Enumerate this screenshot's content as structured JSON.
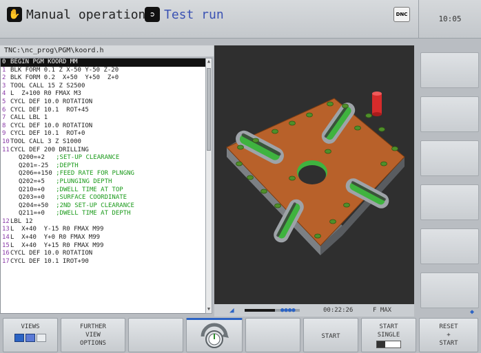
{
  "header": {
    "primary_mode": "Manual operation",
    "secondary_mode": "Test run",
    "dnc_badge": "DNC",
    "clock": "10:05"
  },
  "program": {
    "path": "TNC:\\nc_prog\\PGM\\koord.h",
    "lines": [
      {
        "n": "0",
        "code": "BEGIN PGM KOORD MM"
      },
      {
        "n": "1",
        "code": "BLK FORM 0.1 Z X-50 Y-50 Z-20"
      },
      {
        "n": "2",
        "code": "BLK FORM 0.2  X+50  Y+50  Z+0"
      },
      {
        "n": "3",
        "code": "TOOL CALL 15 Z S2500"
      },
      {
        "n": "4",
        "code": "L  Z+100 R0 FMAX M3"
      },
      {
        "n": "5",
        "code": "CYCL DEF 10.0 ROTATION"
      },
      {
        "n": "6",
        "code": "CYCL DEF 10.1  ROT+45"
      },
      {
        "n": "7",
        "code": "CALL LBL 1"
      },
      {
        "n": "8",
        "code": "CYCL DEF 10.0 ROTATION"
      },
      {
        "n": "9",
        "code": "CYCL DEF 10.1  ROT+0"
      },
      {
        "n": "10",
        "code": "TOOL CALL 3 Z S1000"
      },
      {
        "n": "11",
        "code": "CYCL DEF 200 DRILLING"
      },
      {
        "n": "",
        "code": "Q200=+2",
        "comment": ";SET-UP CLEARANCE"
      },
      {
        "n": "",
        "code": "Q201=-25",
        "comment": ";DEPTH"
      },
      {
        "n": "",
        "code": "Q206=+150",
        "comment": ";FEED RATE FOR PLNGNG"
      },
      {
        "n": "",
        "code": "Q202=+5",
        "comment": ";PLUNGING DEPTH"
      },
      {
        "n": "",
        "code": "Q210=+0",
        "comment": ";DWELL TIME AT TOP"
      },
      {
        "n": "",
        "code": "Q203=+0",
        "comment": ";SURFACE COORDINATE"
      },
      {
        "n": "",
        "code": "Q204=+50",
        "comment": ";2ND SET-UP CLEARANCE"
      },
      {
        "n": "",
        "code": "Q211=+0",
        "comment": ";DWELL TIME AT DEPTH"
      },
      {
        "n": "12",
        "code": "LBL 12"
      },
      {
        "n": "13",
        "code": "L  X+40  Y-15 R0 FMAX M99"
      },
      {
        "n": "14",
        "code": "L  X+40  Y+0 R0 FMAX M99"
      },
      {
        "n": "15",
        "code": "L  X+40  Y+15 R0 FMAX M99"
      },
      {
        "n": "16",
        "code": "CYCL DEF 10.0 ROTATION"
      },
      {
        "n": "17",
        "code": "CYCL DEF 10.1 IROT+90"
      }
    ]
  },
  "status": {
    "time": "00:22:26",
    "feed": "F MAX",
    "progress": 0.55
  },
  "softkeys": [
    {
      "label": "VIEWS",
      "name": "views-softkey"
    },
    {
      "label": "FURTHER\nVIEW\nOPTIONS",
      "name": "further-view-options-softkey"
    },
    {
      "label": "",
      "name": "blank-softkey-3"
    },
    {
      "label": "",
      "name": "speed-dial-softkey"
    },
    {
      "label": "",
      "name": "blank-softkey-5"
    },
    {
      "label": "START",
      "name": "start-softkey"
    },
    {
      "label": "START\nSINGLE",
      "name": "start-single-softkey"
    },
    {
      "label": "RESET\n+\nSTART",
      "name": "reset-start-softkey"
    }
  ],
  "colors": {
    "plate": "#b8612a",
    "slot": "#3fb33f",
    "tool": "#d62b2b",
    "selection": "#111111",
    "active_softkey": "#2b63c4"
  }
}
